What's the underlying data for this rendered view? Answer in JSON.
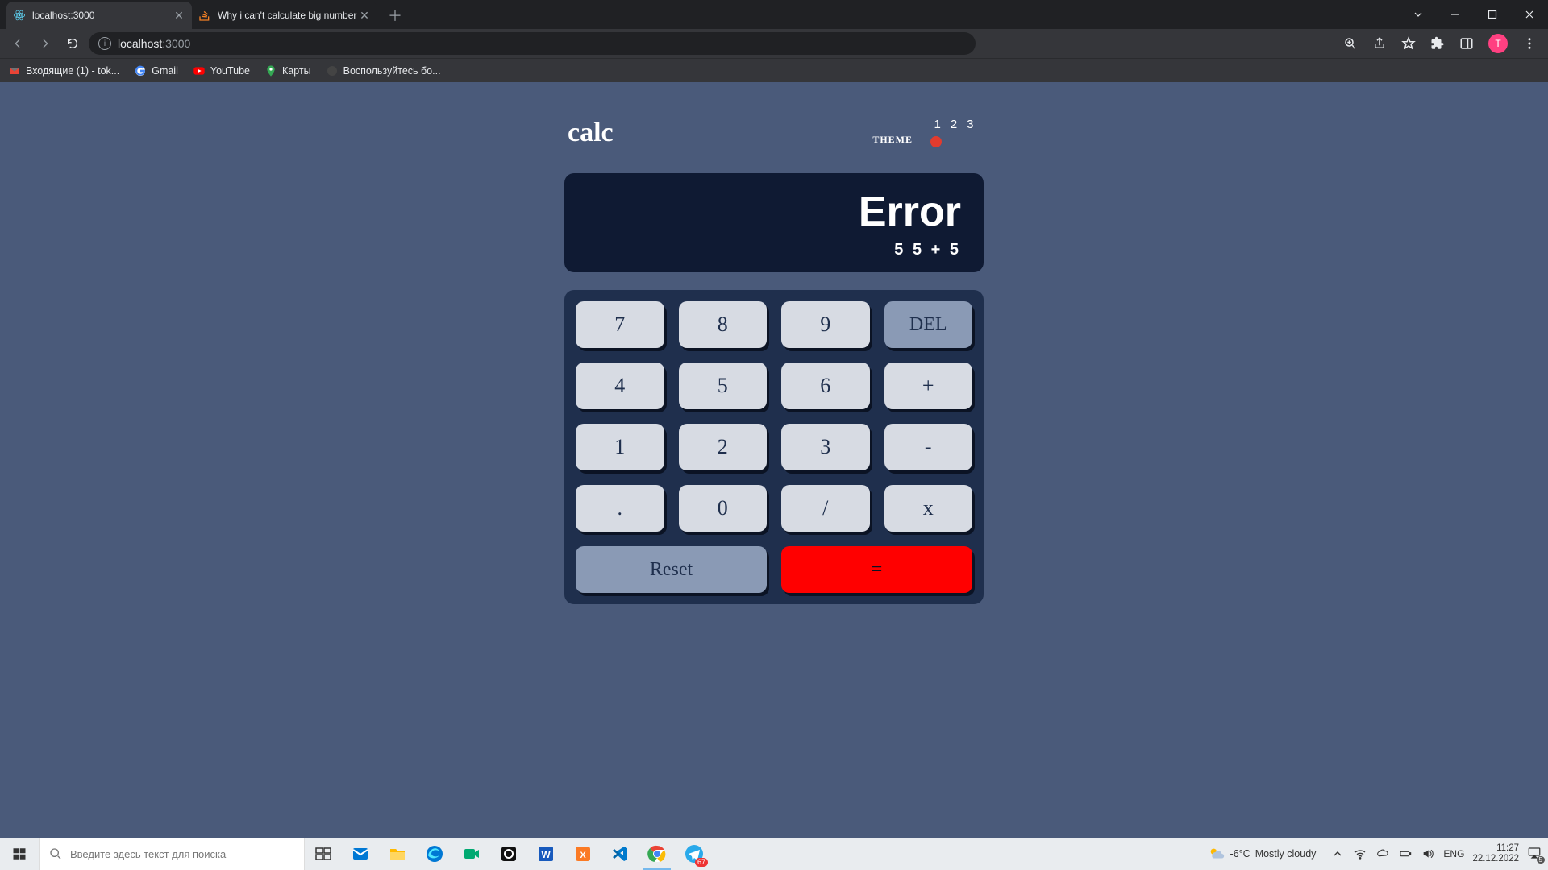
{
  "browser": {
    "tabs": [
      {
        "title": "localhost:3000",
        "favicon": "react"
      },
      {
        "title": "Why i can't calculate big number",
        "favicon": "stackoverflow"
      }
    ],
    "url_host": "localhost",
    "url_port": ":3000",
    "avatar_letter": "T",
    "bookmarks": [
      {
        "icon": "gmail",
        "label": "Входящие (1) - tok..."
      },
      {
        "icon": "google",
        "label": "Gmail"
      },
      {
        "icon": "youtube",
        "label": "YouTube"
      },
      {
        "icon": "gmaps",
        "label": "Карты"
      },
      {
        "icon": "generic",
        "label": "Воспользуйтесь бо..."
      }
    ]
  },
  "calc": {
    "brand": "calc",
    "theme_label": "THEME",
    "theme_options": [
      "1",
      "2",
      "3"
    ],
    "display_main": "Error",
    "display_sub": "5 5 + 5",
    "keys": {
      "k7": "7",
      "k8": "8",
      "k9": "9",
      "del": "DEL",
      "k4": "4",
      "k5": "5",
      "k6": "6",
      "plus": "+",
      "k1": "1",
      "k2": "2",
      "k3": "3",
      "minus": "-",
      "dot": ".",
      "k0": "0",
      "div": "/",
      "mul": "x",
      "reset": "Reset",
      "eq": "="
    }
  },
  "taskbar": {
    "search_placeholder": "Введите здесь текст для поиска",
    "weather_temp": "-6°C",
    "weather_desc": "Mostly cloudy",
    "lang": "ENG",
    "time": "11:27",
    "date": "22.12.2022",
    "notif_count": "5",
    "telegram_badge": "67"
  }
}
